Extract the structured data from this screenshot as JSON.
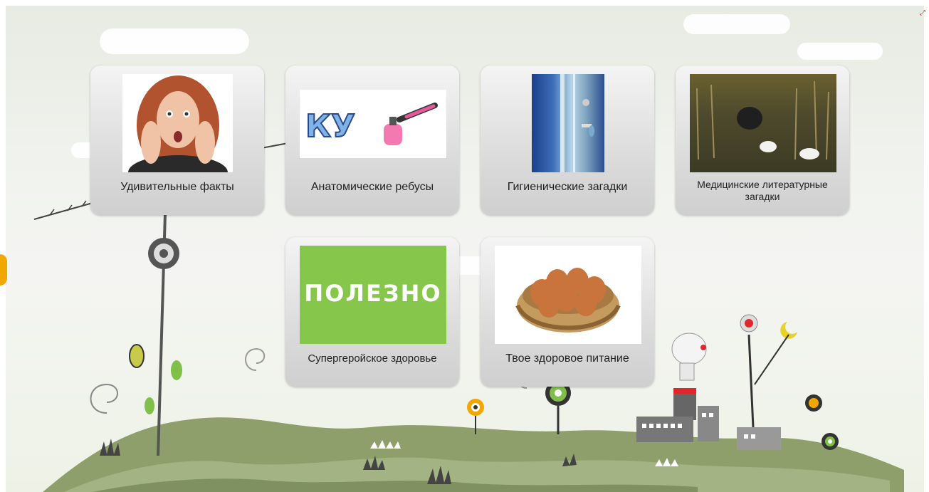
{
  "tiles": [
    {
      "label": "Удивительные факты",
      "image": "surprised-woman-photo"
    },
    {
      "label": "Анатомические ребусы",
      "image": "rebus-ky-nail-polish"
    },
    {
      "label": "Гигиенические загадки",
      "image": "shower-photo"
    },
    {
      "label": "Медицинские литературные загадки",
      "image": "swamp-scene-photo"
    },
    {
      "label": "Супергеройское здоровье",
      "image": "green-poleзно-card",
      "image_text": "ПОЛЕЗНО"
    },
    {
      "label": "Твое здоровое питание",
      "image": "eggs-basket-photo"
    }
  ],
  "rebus_text": "КУ",
  "colors": {
    "accent_orange": "#f2a600",
    "tile_top": "#f4f4f4",
    "tile_bottom": "#cfcfcf",
    "green_card": "#86c64a",
    "hill_green": "#8e9f6c"
  },
  "icons": [
    "expand-icon"
  ]
}
